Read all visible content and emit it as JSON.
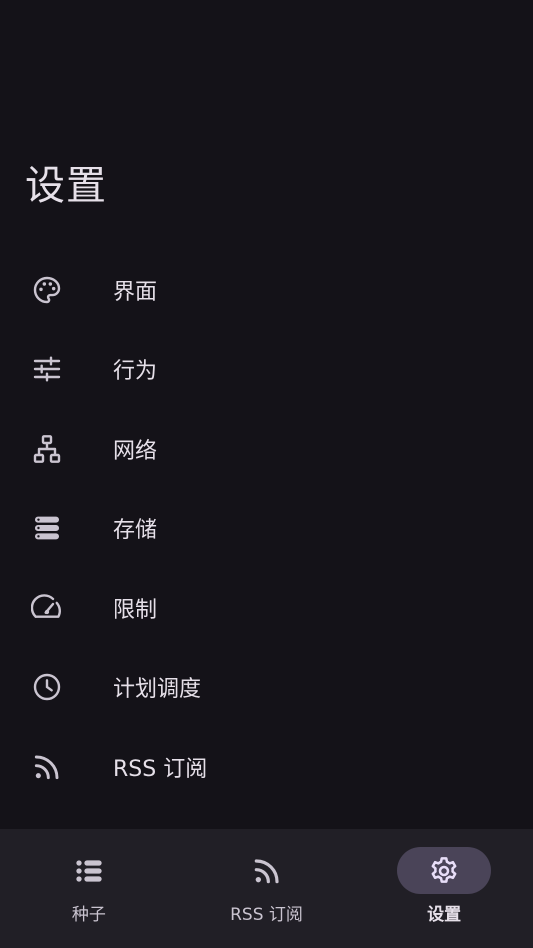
{
  "page": {
    "title": "设置"
  },
  "settings": {
    "items": [
      {
        "label": "界面",
        "icon": "palette-icon"
      },
      {
        "label": "行为",
        "icon": "tune-icon"
      },
      {
        "label": "网络",
        "icon": "network-icon"
      },
      {
        "label": "存储",
        "icon": "storage-icon"
      },
      {
        "label": "限制",
        "icon": "speed-icon"
      },
      {
        "label": "计划调度",
        "icon": "clock-icon"
      },
      {
        "label": "RSS 订阅",
        "icon": "rss-icon"
      }
    ]
  },
  "bottom_nav": {
    "items": [
      {
        "label": "种子",
        "icon": "list-icon",
        "active": false
      },
      {
        "label": "RSS 订阅",
        "icon": "rss-icon",
        "active": false
      },
      {
        "label": "设置",
        "icon": "gear-icon",
        "active": true
      }
    ]
  },
  "colors": {
    "background": "#141218",
    "nav_background": "#211F26",
    "active_indicator": "#4A4458",
    "text": "#E6E0E9",
    "icon": "#CAC4D0"
  }
}
